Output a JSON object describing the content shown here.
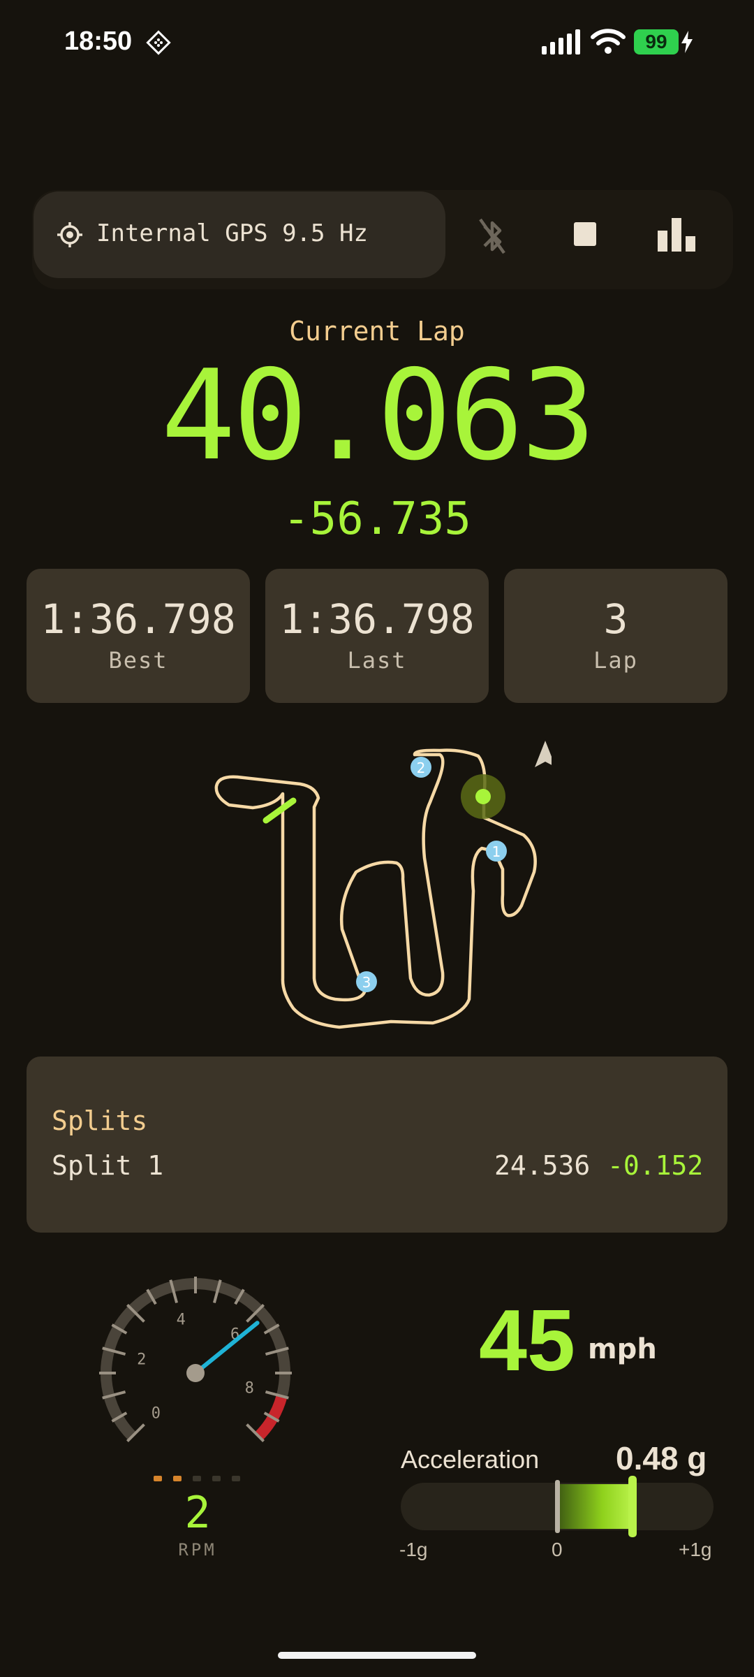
{
  "status_bar": {
    "time": "18:50",
    "battery": "99",
    "battery_color": "#2fd04e"
  },
  "toolbar": {
    "gps_source": "Internal GPS 9.5 Hz",
    "icons": [
      "crosshair-icon",
      "bluetooth-disabled-icon",
      "stop-icon",
      "bar-chart-icon"
    ]
  },
  "current_lap": {
    "title": "Current Lap",
    "time": "40.063",
    "delta": "-56.735"
  },
  "stats": [
    {
      "value": "1:36.798",
      "label": "Best"
    },
    {
      "value": "1:36.798",
      "label": "Last"
    },
    {
      "value": "3",
      "label": "Lap"
    }
  ],
  "track": {
    "markers": [
      "1",
      "2",
      "3"
    ],
    "track_color": "#f6d9a6",
    "marker_color": "#8ccfee"
  },
  "splits": {
    "title": "Splits",
    "rows": [
      {
        "name": "Split 1",
        "time": "24.536",
        "delta": "-0.152"
      }
    ]
  },
  "rpm": {
    "ticks": [
      "0",
      "2",
      "4",
      "6",
      "8"
    ],
    "value": "2",
    "label": "RPM",
    "needle_value": 6.2,
    "max": 9,
    "redline": 8
  },
  "speed": {
    "value": "45",
    "unit": "mph"
  },
  "acceleration": {
    "label": "Acceleration",
    "value": "0.48 g",
    "g": 0.48,
    "tick_min": "-1g",
    "tick_zero": "0",
    "tick_max": "+1g"
  },
  "accent_color": "#a8f43a"
}
